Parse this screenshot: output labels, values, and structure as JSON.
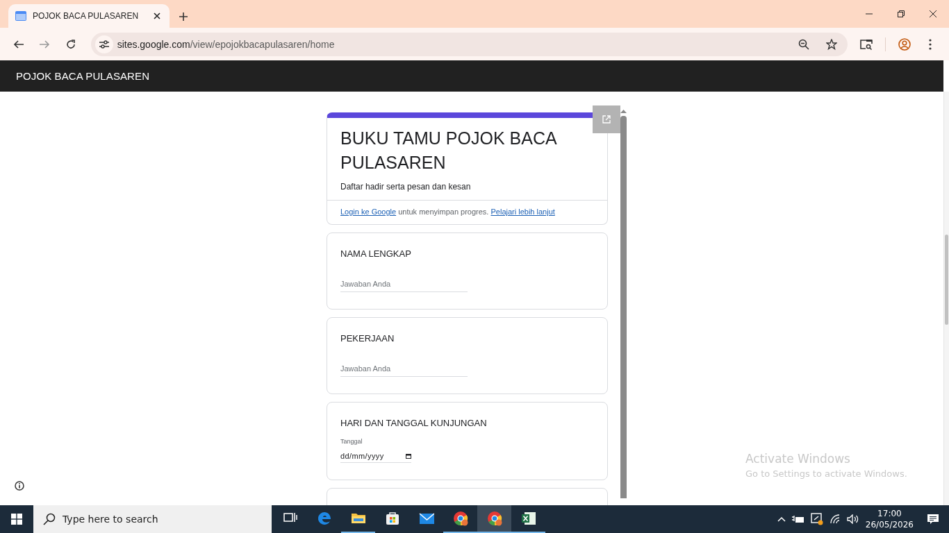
{
  "browser": {
    "tab": {
      "title": "POJOK BACA PULASAREN"
    },
    "url": {
      "host": "sites.google.com",
      "path": "/view/epojokbacapulasaren/home"
    }
  },
  "site": {
    "title": "POJOK BACA PULASAREN"
  },
  "form": {
    "title": "BUKU TAMU POJOK BACA PULASAREN",
    "description": "Daftar hadir serta pesan dan kesan",
    "login_notice": {
      "link": "Login ke Google",
      "text": "untuk menyimpan progres.",
      "learn_more": "Pelajari lebih lanjut"
    },
    "questions": [
      {
        "kind": "text",
        "title": "NAMA LENGKAP",
        "placeholder": "Jawaban Anda"
      },
      {
        "kind": "text",
        "title": "PEKERJAAN",
        "placeholder": "Jawaban Anda"
      },
      {
        "kind": "date",
        "title": "HARI DAN TANGGAL KUNJUNGAN",
        "field_label": "Tanggal",
        "placeholder": "dd/mm/yyyy"
      },
      {
        "kind": "partial"
      }
    ]
  },
  "activation_notice": {
    "title": "Activate Windows",
    "text": "Go to Settings to activate Windows."
  },
  "taskbar": {
    "search": {
      "placeholder": "Type here to search"
    },
    "apps": [
      {
        "kind": "task-view",
        "open": false,
        "selected": false
      },
      {
        "kind": "edge",
        "open": false,
        "selected": false
      },
      {
        "kind": "explorer",
        "open": true,
        "selected": false
      },
      {
        "kind": "store",
        "open": false,
        "selected": false
      },
      {
        "kind": "mail",
        "open": false,
        "selected": false
      },
      {
        "kind": "chrome",
        "open": true,
        "selected": false
      },
      {
        "kind": "chrome",
        "open": true,
        "selected": true
      },
      {
        "kind": "excel",
        "open": true,
        "selected": false
      }
    ],
    "clock": {
      "time": "17:00",
      "date": "26/05/2026"
    }
  }
}
